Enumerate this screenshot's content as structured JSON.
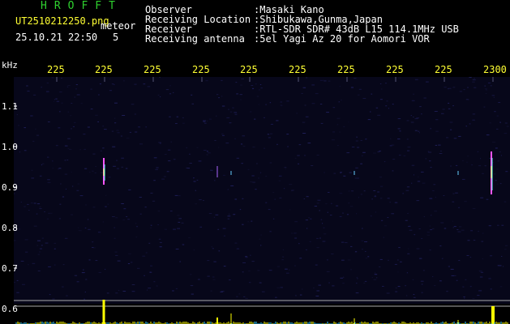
{
  "header": {
    "title": "HROFFT",
    "filename": "UT2510212250.png",
    "mode": "meteor",
    "datetime": "25.10.21 22:50",
    "count": "5",
    "labels": [
      "Observer",
      "Receiving Location",
      "Receiver",
      "Receiving antenna"
    ],
    "values": [
      ":Masaki Kano",
      ":Shibukawa,Gunma,Japan",
      ":RTL-SDR SDR# 43dB L15 114.1MHz USB",
      ":5el Yagi Az 20 for Aomori VOR"
    ]
  },
  "axes": {
    "y_unit": "kHz",
    "y_ticks": [
      "1.1",
      "1.0",
      "0.9",
      "0.8",
      "0.7",
      "0.6"
    ],
    "x_ticks": [
      "225",
      "225",
      "225",
      "225",
      "225",
      "225",
      "225",
      "225",
      "225",
      "2300"
    ]
  },
  "colors": {
    "title": "#2fd12f",
    "tick_labels": "#ffff33",
    "background": "#000000",
    "spectro_bg": "#07071a",
    "baseline": "#ffff00"
  }
}
